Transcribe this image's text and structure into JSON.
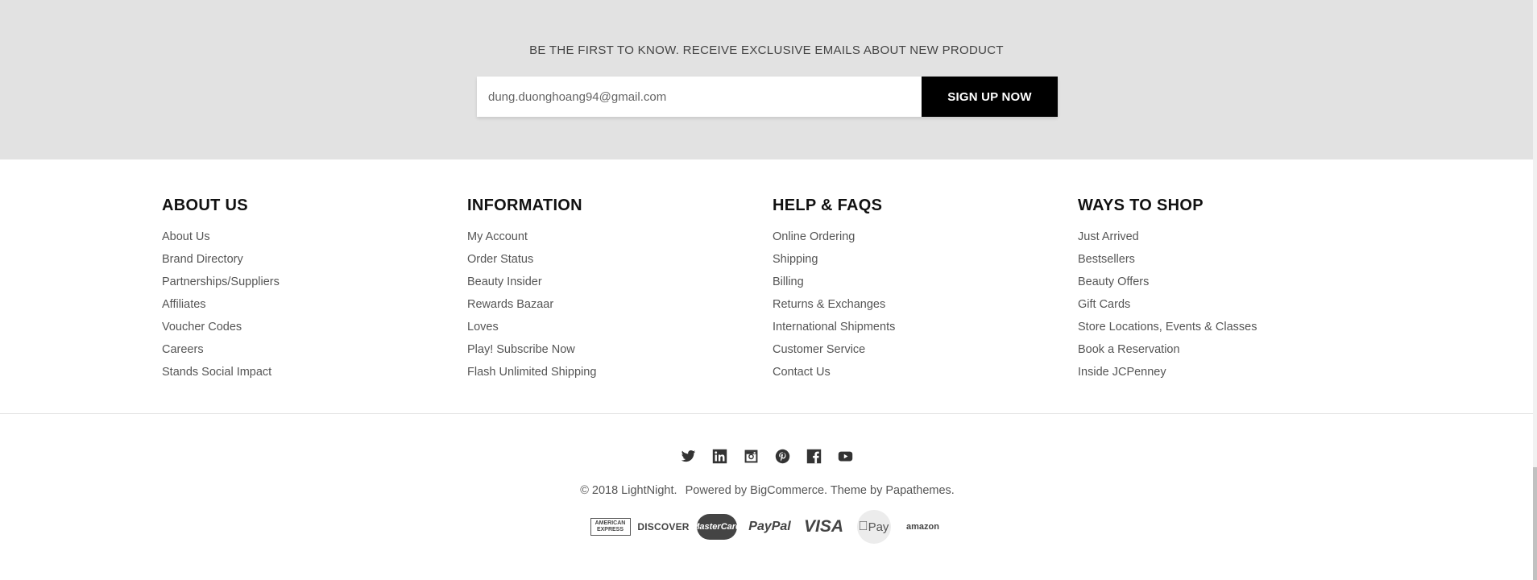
{
  "newsletter": {
    "heading": "BE THE FIRST TO KNOW. RECEIVE EXCLUSIVE EMAILS ABOUT NEW PRODUCT",
    "email_value": "dung.duonghoang94@gmail.com",
    "button_label": "SIGN UP NOW"
  },
  "footer": {
    "columns": [
      {
        "title": "ABOUT US",
        "items": [
          "About Us",
          "Brand Directory",
          "Partnerships/Suppliers",
          "Affiliates",
          "Voucher Codes",
          "Careers",
          "Stands Social Impact"
        ]
      },
      {
        "title": "INFORMATION",
        "items": [
          "My Account",
          "Order Status",
          "Beauty Insider",
          "Rewards Bazaar",
          "Loves",
          "Play! Subscribe Now",
          "Flash Unlimited Shipping"
        ]
      },
      {
        "title": "HELP & FAQS",
        "items": [
          "Online Ordering",
          "Shipping",
          "Billing",
          "Returns & Exchanges",
          "International Shipments",
          "Customer Service",
          "Contact Us"
        ]
      },
      {
        "title": "WAYS TO SHOP",
        "items": [
          "Just Arrived",
          "Bestsellers",
          "Beauty Offers",
          "Gift Cards",
          "Store Locations, Events & Classes",
          "Book a Reservation",
          "Inside JCPenney"
        ]
      }
    ]
  },
  "social": [
    "twitter-icon",
    "linkedin-icon",
    "instagram-icon",
    "pinterest-icon",
    "facebook-icon",
    "youtube-icon"
  ],
  "copyright": {
    "prefix": "© 2018 LightNight.",
    "powered_by": "Powered by BigCommerce.",
    "theme_by": "Theme by Papathemes."
  },
  "payments": {
    "amex_line1": "AMERICAN",
    "amex_line2": "EXPRESS",
    "discover": "DISCOVER",
    "mastercard": "MasterCard",
    "paypal": "PayPal",
    "visa": "VISA",
    "applepay": "Pay",
    "amazon": "amazon"
  },
  "colors": {
    "newsletter_bg": "#e2e2e2",
    "button_bg": "#000000",
    "heading_text": "#111111",
    "link_text": "#555555"
  }
}
